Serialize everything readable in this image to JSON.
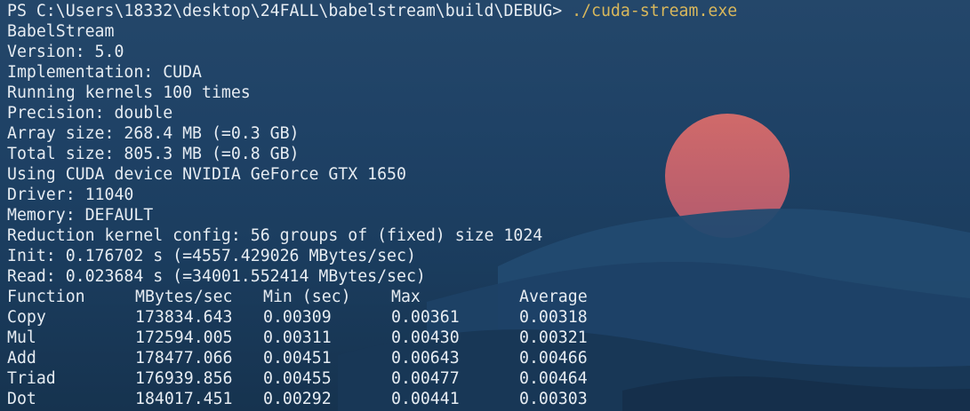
{
  "terminal": {
    "prompt": "PS C:\\Users\\18332\\desktop\\24FALL\\babelstream\\build\\DEBUG> ",
    "command": "./cuda-stream.exe",
    "output_lines": [
      "BabelStream",
      "Version: 5.0",
      "Implementation: CUDA",
      "Running kernels 100 times",
      "Precision: double",
      "Array size: 268.4 MB (=0.3 GB)",
      "Total size: 805.3 MB (=0.8 GB)",
      "Using CUDA device NVIDIA GeForce GTX 1650",
      "Driver: 11040",
      "Memory: DEFAULT",
      "Reduction kernel config: 56 groups of (fixed) size 1024",
      "Init: 0.176702 s (=4557.429026 MBytes/sec)",
      "Read: 0.023684 s (=34001.552414 MBytes/sec)"
    ],
    "results_table": {
      "headers": [
        "Function",
        "MBytes/sec",
        "Min (sec)",
        "Max",
        "Average"
      ],
      "rows": [
        [
          "Copy",
          "173834.643",
          "0.00309",
          "0.00361",
          "0.00318"
        ],
        [
          "Mul",
          "172594.005",
          "0.00311",
          "0.00430",
          "0.00321"
        ],
        [
          "Add",
          "178477.066",
          "0.00451",
          "0.00643",
          "0.00466"
        ],
        [
          "Triad",
          "176939.856",
          "0.00455",
          "0.00477",
          "0.00464"
        ],
        [
          "Dot",
          "184017.451",
          "0.00292",
          "0.00441",
          "0.00303"
        ]
      ]
    }
  },
  "colors": {
    "text": "#e6ecf2",
    "command": "#d8b75c",
    "background": "#1f4266",
    "sun": "#c9646a"
  }
}
